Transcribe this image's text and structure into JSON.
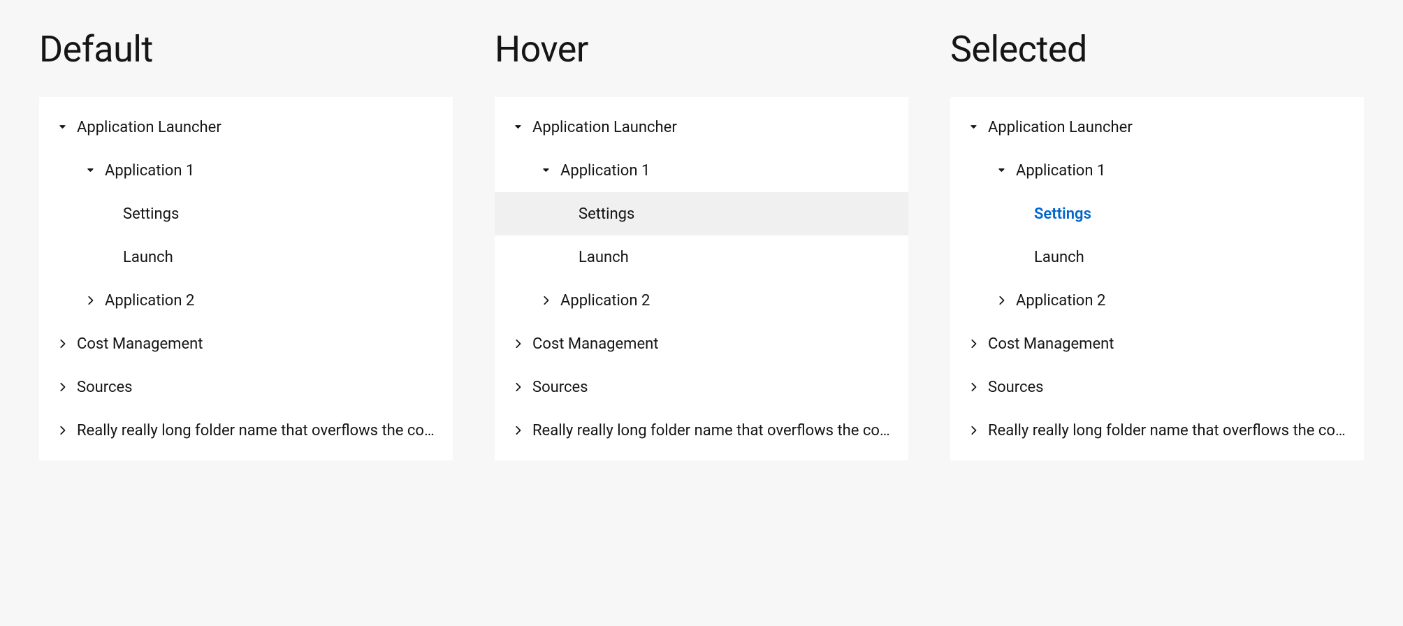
{
  "columns": [
    {
      "id": "default",
      "heading": "Default"
    },
    {
      "id": "hover",
      "heading": "Hover"
    },
    {
      "id": "selected",
      "heading": "Selected"
    }
  ],
  "tree": {
    "app_launcher": "Application Launcher",
    "app1": "Application 1",
    "settings": "Settings",
    "launch": "Launch",
    "app2": "Application 2",
    "cost_mgmt": "Cost Management",
    "sources": "Sources",
    "long_folder": "Really really long folder name that overflows the container it is inside of"
  },
  "colors": {
    "accent": "#0066cc",
    "hover_bg": "#f0f0f0"
  }
}
